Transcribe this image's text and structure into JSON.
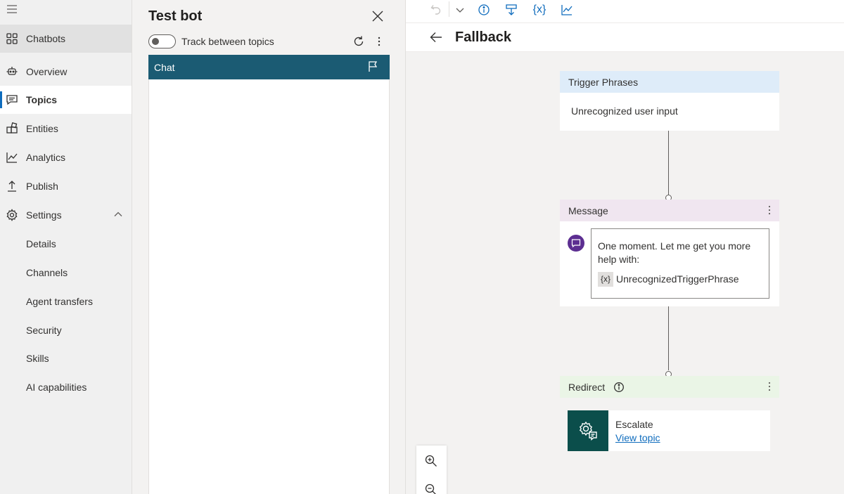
{
  "nav": {
    "top_item": "Chatbots",
    "items": [
      {
        "label": "Overview",
        "icon": "overview-icon"
      },
      {
        "label": "Topics",
        "icon": "topics-icon",
        "active": true
      },
      {
        "label": "Entities",
        "icon": "entities-icon"
      },
      {
        "label": "Analytics",
        "icon": "analytics-icon"
      },
      {
        "label": "Publish",
        "icon": "publish-icon"
      },
      {
        "label": "Settings",
        "icon": "settings-icon",
        "expanded": true
      }
    ],
    "settings_children": [
      "Details",
      "Channels",
      "Agent transfers",
      "Security",
      "Skills",
      "AI capabilities"
    ]
  },
  "test_bot": {
    "title": "Test bot",
    "toggle_label": "Track between topics",
    "toggle_on": false,
    "chat_tab": "Chat"
  },
  "canvas": {
    "title": "Fallback",
    "toolbar": {
      "variables_label": "{x}"
    },
    "trigger": {
      "header": "Trigger Phrases",
      "text": "Unrecognized user input"
    },
    "message": {
      "header": "Message",
      "text": "One moment. Let me get you more help with:",
      "variable_icon": "{x}",
      "variable": "UnrecognizedTriggerPhrase"
    },
    "redirect": {
      "header": "Redirect",
      "topic_name": "Escalate",
      "link": "View topic"
    }
  },
  "colors": {
    "chat_header": "#1b5b73",
    "accent": "#0f6cbd",
    "trigger_header": "#deecf9",
    "message_header": "#f0e6f0",
    "redirect_header": "#eaf5e6",
    "message_avatar": "#5c2e91",
    "redirect_tile": "#0b4e4b"
  }
}
